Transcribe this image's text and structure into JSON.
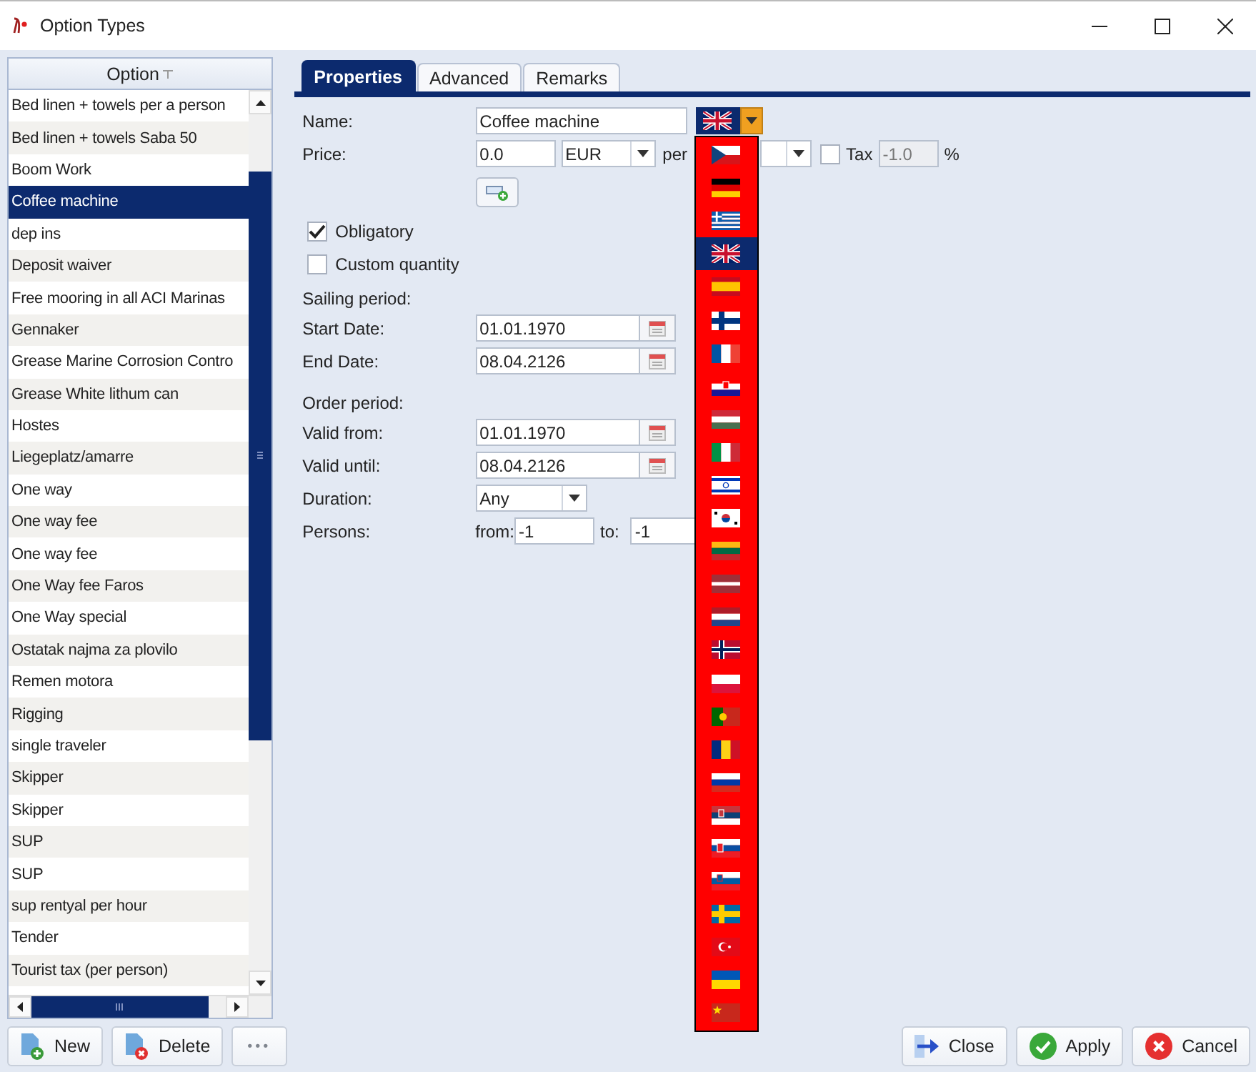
{
  "window": {
    "title": "Option Types"
  },
  "options_list": {
    "header": "Option",
    "rows": [
      {
        "label": "Bed linen + towels per a person",
        "selected": false
      },
      {
        "label": "Bed linen + towels Saba 50",
        "selected": false
      },
      {
        "label": "Boom Work",
        "selected": false
      },
      {
        "label": "Coffee machine",
        "selected": true
      },
      {
        "label": "dep ins",
        "selected": false
      },
      {
        "label": "Deposit waiver",
        "selected": false
      },
      {
        "label": "Free mooring in all ACI Marinas",
        "selected": false
      },
      {
        "label": "Gennaker",
        "selected": false
      },
      {
        "label": "Grease Marine Corrosion Contro",
        "selected": false
      },
      {
        "label": "Grease  White lithum can",
        "selected": false
      },
      {
        "label": "Hostes",
        "selected": false
      },
      {
        "label": "Liegeplatz/amarre",
        "selected": false
      },
      {
        "label": "One way",
        "selected": false
      },
      {
        "label": "One way fee",
        "selected": false
      },
      {
        "label": "One way fee",
        "selected": false
      },
      {
        "label": "One Way fee Faros",
        "selected": false
      },
      {
        "label": "One Way special",
        "selected": false
      },
      {
        "label": "Ostatak najma za plovilo",
        "selected": false
      },
      {
        "label": "Remen motora",
        "selected": false
      },
      {
        "label": "Rigging",
        "selected": false
      },
      {
        "label": "single traveler",
        "selected": false
      },
      {
        "label": "Skipper",
        "selected": false
      },
      {
        "label": "Skipper",
        "selected": false
      },
      {
        "label": "SUP",
        "selected": false
      },
      {
        "label": "SUP",
        "selected": false
      },
      {
        "label": "sup rentyal per hour",
        "selected": false
      },
      {
        "label": "Tender",
        "selected": false
      },
      {
        "label": "Tourist tax (per  person)",
        "selected": false
      }
    ]
  },
  "tabs": [
    {
      "label": "Properties",
      "selected": true
    },
    {
      "label": "Advanced",
      "selected": false
    },
    {
      "label": "Remarks",
      "selected": false
    }
  ],
  "form": {
    "name": {
      "label": "Name:",
      "value": "Coffee machine"
    },
    "price": {
      "label": "Price:",
      "value": "0.0",
      "currency": "EUR",
      "per_label": "per"
    },
    "tax": {
      "checked": false,
      "label": "Tax",
      "value": "-1.0",
      "disabled": true,
      "unit": "%"
    },
    "obligatory": {
      "label": "Obligatory",
      "checked": true
    },
    "custom_quantity": {
      "label": "Custom quantity",
      "checked": false
    },
    "sailing_period": {
      "heading": "Sailing period:",
      "start": {
        "label": "Start Date:",
        "value": "01.01.1970"
      },
      "end": {
        "label": "End Date:",
        "value": "08.04.2126"
      }
    },
    "order_period": {
      "heading": "Order period:",
      "start": {
        "label": "Valid from:",
        "value": "01.01.1970"
      },
      "end": {
        "label": "Valid until:",
        "value": "08.04.2126"
      }
    },
    "duration": {
      "label": "Duration:",
      "value": "Any"
    },
    "persons": {
      "label": "Persons:",
      "from_label": "from:",
      "from_value": "-1",
      "to_label": "to:",
      "to_value": "-1"
    }
  },
  "language_dropdown": {
    "expanded": true,
    "flags": [
      {
        "kind": "cz",
        "selected": false
      },
      {
        "kind": "de",
        "selected": false
      },
      {
        "kind": "gr",
        "selected": false
      },
      {
        "kind": "gb",
        "selected": true
      },
      {
        "kind": "es",
        "selected": false
      },
      {
        "kind": "fi",
        "selected": false
      },
      {
        "kind": "fr",
        "selected": false
      },
      {
        "kind": "hr",
        "selected": false
      },
      {
        "kind": "hu",
        "selected": false
      },
      {
        "kind": "it",
        "selected": false
      },
      {
        "kind": "il",
        "selected": false
      },
      {
        "kind": "kr",
        "selected": false
      },
      {
        "kind": "lt",
        "selected": false
      },
      {
        "kind": "lv",
        "selected": false
      },
      {
        "kind": "nl",
        "selected": false
      },
      {
        "kind": "no",
        "selected": false
      },
      {
        "kind": "pl",
        "selected": false
      },
      {
        "kind": "pt",
        "selected": false
      },
      {
        "kind": "ro",
        "selected": false
      },
      {
        "kind": "ru",
        "selected": false
      },
      {
        "kind": "rs",
        "selected": false
      },
      {
        "kind": "sk",
        "selected": false
      },
      {
        "kind": "si",
        "selected": false
      },
      {
        "kind": "se",
        "selected": false
      },
      {
        "kind": "tr",
        "selected": false
      },
      {
        "kind": "ua",
        "selected": false
      },
      {
        "kind": "cn",
        "selected": false
      }
    ]
  },
  "left_buttons": [
    {
      "kind": "new",
      "label": "New",
      "disabled": false
    },
    {
      "kind": "delete",
      "label": "Delete",
      "disabled": false
    },
    {
      "kind": "more",
      "label": "•••",
      "disabled": true
    }
  ],
  "right_buttons": [
    {
      "kind": "close",
      "label": "Close"
    },
    {
      "kind": "apply",
      "label": "Apply"
    },
    {
      "kind": "cancel",
      "label": "Cancel"
    }
  ]
}
